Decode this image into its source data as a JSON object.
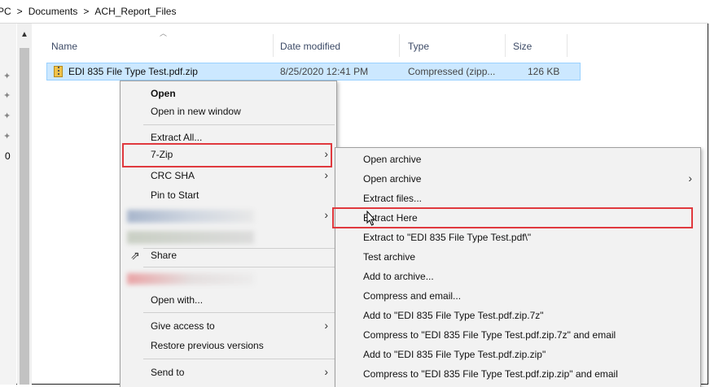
{
  "breadcrumb": {
    "items": [
      "PC",
      "Documents",
      "ACH_Report_Files"
    ],
    "separator": ">"
  },
  "columns": {
    "name": "Name",
    "date": "Date modified",
    "type": "Type",
    "size": "Size"
  },
  "left_pane_label": "0",
  "file": {
    "name": "EDI 835 File Type Test.pdf.zip",
    "date": "8/25/2020 12:41 PM",
    "type": "Compressed (zipp...",
    "size": "126 KB"
  },
  "context_menu": {
    "open": "Open",
    "open_new_window": "Open in new window",
    "extract_all": "Extract All...",
    "seven_zip": "7-Zip",
    "crc_sha": "CRC SHA",
    "pin_to_start": "Pin to Start",
    "share": "Share",
    "open_with": "Open with...",
    "give_access": "Give access to",
    "restore_versions": "Restore previous versions",
    "send_to": "Send to"
  },
  "submenu": {
    "items": [
      "Open archive",
      "Open archive",
      "Extract files...",
      "Extract Here",
      "Extract to \"EDI 835 File Type Test.pdf\\\"",
      "Test archive",
      "Add to archive...",
      "Compress and email...",
      "Add to \"EDI 835 File Type Test.pdf.zip.7z\"",
      "Compress to \"EDI 835 File Type Test.pdf.zip.7z\" and email",
      "Add to \"EDI 835 File Type Test.pdf.zip.zip\"",
      "Compress to \"EDI 835 File Type Test.pdf.zip.zip\" and email"
    ]
  },
  "colors": {
    "selection_bg": "#cce8ff",
    "selection_border": "#99d1ff",
    "menu_bg": "#f2f2f2",
    "highlight_red": "#e0393e"
  },
  "icons": [
    "zip-file-icon",
    "share-icon",
    "chevron-right-icon",
    "pin-icon",
    "sort-up-icon",
    "scroll-up-icon",
    "mouse-cursor-icon"
  ]
}
